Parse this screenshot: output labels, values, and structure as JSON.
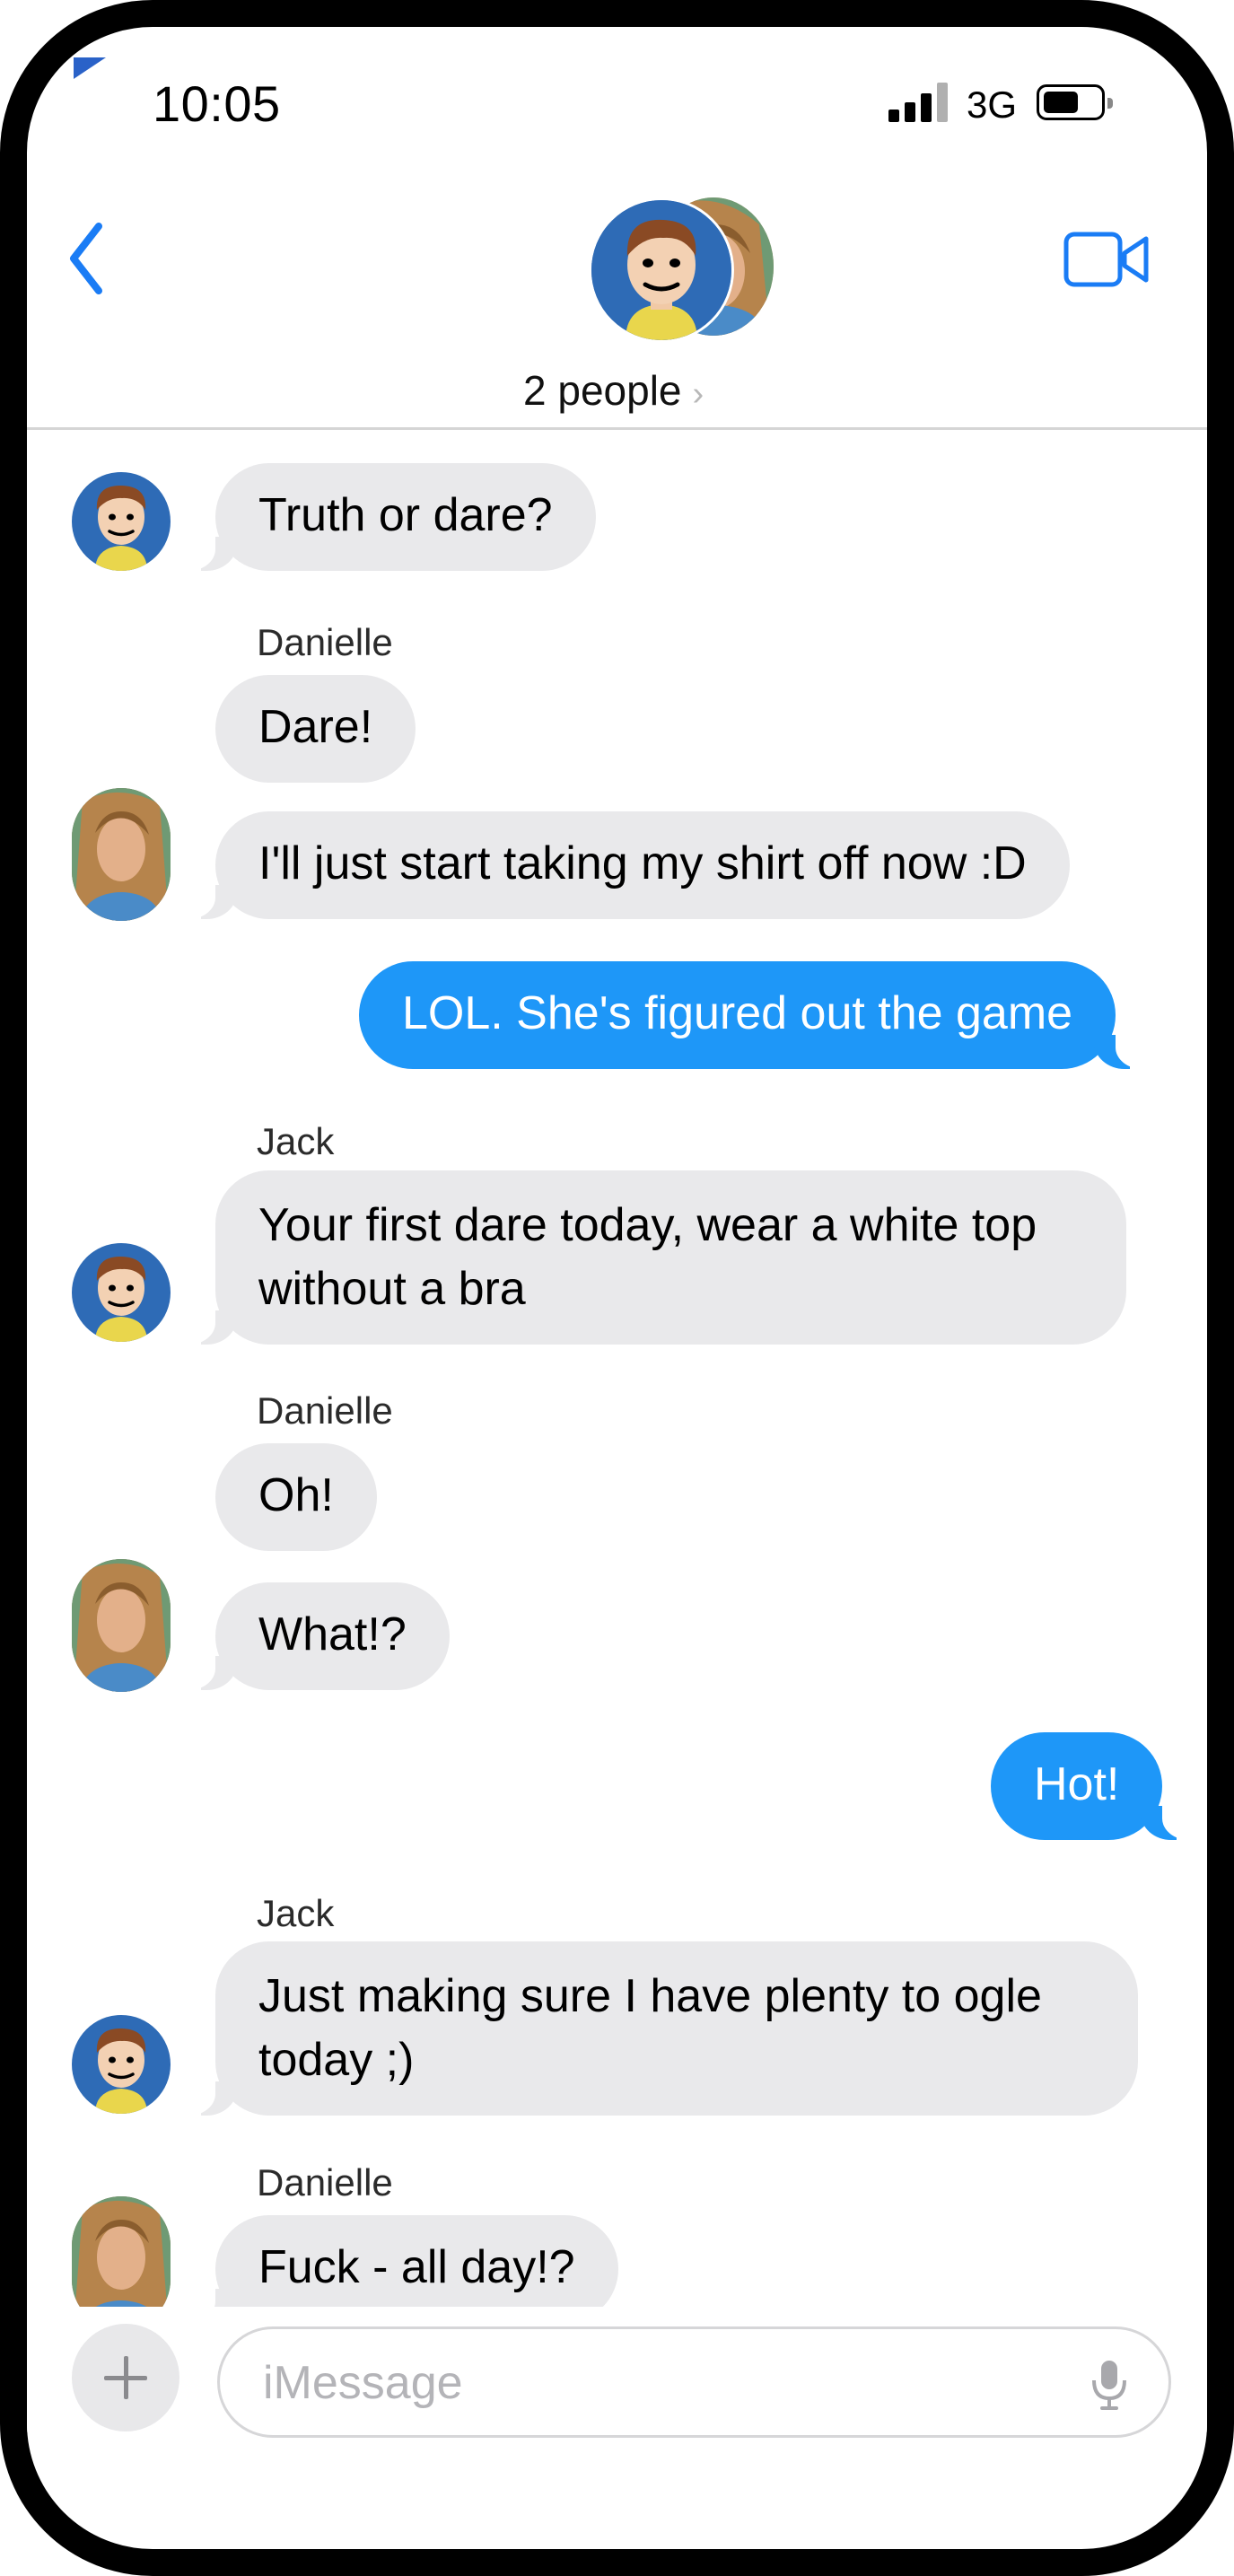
{
  "status_bar": {
    "time": "10:05",
    "network": "3G"
  },
  "header": {
    "people_label": "2 people",
    "chevron": "›"
  },
  "messages": [
    {
      "type": "in",
      "sender": "Jack",
      "text": "Truth or dare?"
    },
    {
      "type": "in",
      "sender": "Danielle",
      "sender_label": "Danielle",
      "text": "Dare!"
    },
    {
      "type": "in",
      "sender": "Danielle",
      "text": "I'll just start taking my shirt off now :D"
    },
    {
      "type": "out",
      "text": "LOL.  She's figured out the game"
    },
    {
      "type": "in",
      "sender": "Jack",
      "sender_label": "Jack",
      "text": "Your first dare today, wear a white top without a bra"
    },
    {
      "type": "in",
      "sender": "Danielle",
      "sender_label": "Danielle",
      "text": "Oh!"
    },
    {
      "type": "in",
      "sender": "Danielle",
      "text": "What!?"
    },
    {
      "type": "out",
      "text": "Hot!"
    },
    {
      "type": "in",
      "sender": "Jack",
      "sender_label": "Jack",
      "text": "Just making sure I have plenty to ogle today ;)"
    },
    {
      "type": "in",
      "sender": "Danielle",
      "sender_label": "Danielle",
      "text": "Fuck - all day!?"
    }
  ],
  "composer": {
    "placeholder": "iMessage"
  },
  "colors": {
    "outgoing": "#1e97f8",
    "incoming": "#e9e9eb",
    "accent": "#1a7cf5"
  },
  "icons": [
    "back-chevron-icon",
    "video-camera-icon",
    "plus-icon",
    "microphone-icon",
    "signal-icon",
    "battery-icon"
  ]
}
